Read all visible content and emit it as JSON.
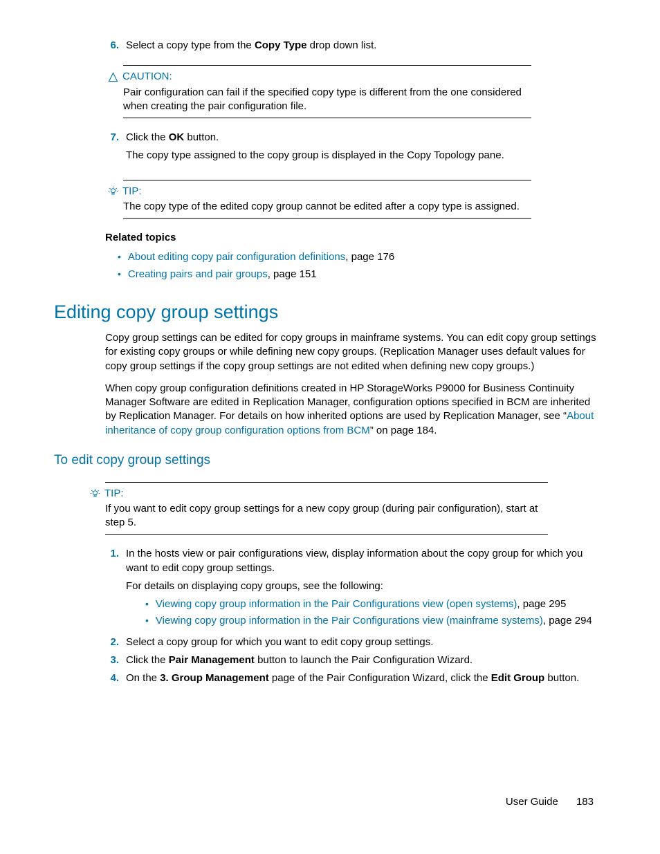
{
  "step6": {
    "num": "6.",
    "pre": "Select a copy type from the ",
    "bold": "Copy Type",
    "post": " drop down list."
  },
  "caution": {
    "label": "CAUTION:",
    "body": "Pair configuration can fail if the specified copy type is different from the one considered when creating the pair configuration file."
  },
  "step7": {
    "num": "7.",
    "pre": "Click the ",
    "bold": "OK",
    "post": " button.",
    "line2": "The copy type assigned to the copy group is displayed in the Copy Topology pane."
  },
  "tip1": {
    "label": "TIP:",
    "body": "The copy type of the edited copy group cannot be edited after a copy type is assigned."
  },
  "related": {
    "heading": "Related topics",
    "items": [
      {
        "link": "About editing copy pair configuration definitions",
        "suffix": ", page 176"
      },
      {
        "link": "Creating pairs and pair groups",
        "suffix": ", page 151"
      }
    ]
  },
  "h2": "Editing copy group settings",
  "p1": "Copy group settings can be edited for copy groups in mainframe systems. You can edit copy group settings for existing copy groups or while defining new copy groups. (Replication Manager uses default values for copy group settings if the copy group settings are not edited when defining new copy groups.)",
  "p2": {
    "a": "When copy group configuration definitions created in HP StorageWorks P9000 for Business Continuity Manager Software are edited in Replication Manager, configuration options specified in BCM are inherited by Replication Manager. For details on how inherited options are used by Replication Manager, see “",
    "link": "About inheritance of copy group configuration options from BCM",
    "b": "” on page 184."
  },
  "h3": "To edit copy group settings",
  "tip2": {
    "label": "TIP:",
    "body": "If you want to edit copy group settings for a new copy group (during pair configuration), start at step 5."
  },
  "s1": {
    "num": "1.",
    "l1": "In the hosts view or pair configurations view, display information about the copy group for which you want to edit copy group settings.",
    "l2": "For details on displaying copy groups, see the following:",
    "b1": {
      "link": "Viewing copy group information in the Pair Configurations view (open systems)",
      "suffix": ", page 295"
    },
    "b2": {
      "link": "Viewing copy group information in the Pair Configurations view (mainframe systems)",
      "suffix": ", page 294"
    }
  },
  "s2": {
    "num": "2.",
    "text": "Select a copy group for which you want to edit copy group settings."
  },
  "s3": {
    "num": "3.",
    "pre": "Click the ",
    "bold": "Pair Management",
    "post": " button to launch the Pair Configuration Wizard."
  },
  "s4": {
    "num": "4.",
    "pre": "On the ",
    "bold1": "3. Group Management",
    "mid": " page of the Pair Configuration Wizard, click the ",
    "bold2": "Edit Group",
    "post": " button."
  },
  "footer": {
    "label": "User Guide",
    "page": "183"
  }
}
